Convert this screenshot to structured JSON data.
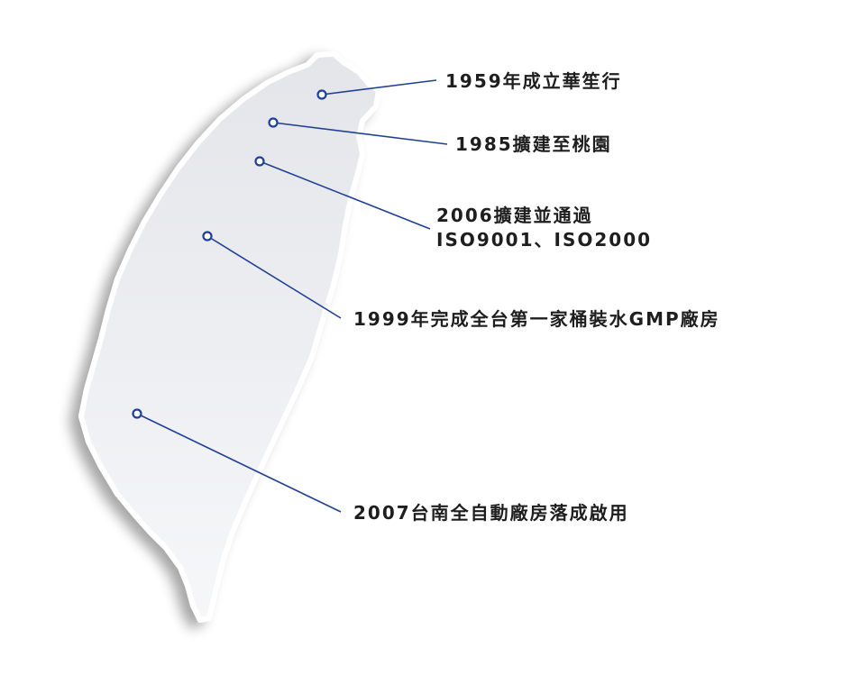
{
  "colors": {
    "accent": "#1f4096",
    "label_text": "#1e1e1e",
    "island_fill_top": "#e4e5ea",
    "island_fill_bottom": "#f6f7f9"
  },
  "milestones": [
    {
      "id": "m1959",
      "lines": [
        "1959年成立華笙行"
      ]
    },
    {
      "id": "m1985",
      "lines": [
        "1985擴建至桃園"
      ]
    },
    {
      "id": "m2006",
      "lines": [
        "2006擴建並通過",
        "ISO9001、ISO2000"
      ]
    },
    {
      "id": "m1999",
      "lines": [
        "1999年完成全台第一家桶裝水GMP廠房"
      ]
    },
    {
      "id": "m2007",
      "lines": [
        "2007台南全自動廠房落成啟用"
      ]
    }
  ]
}
